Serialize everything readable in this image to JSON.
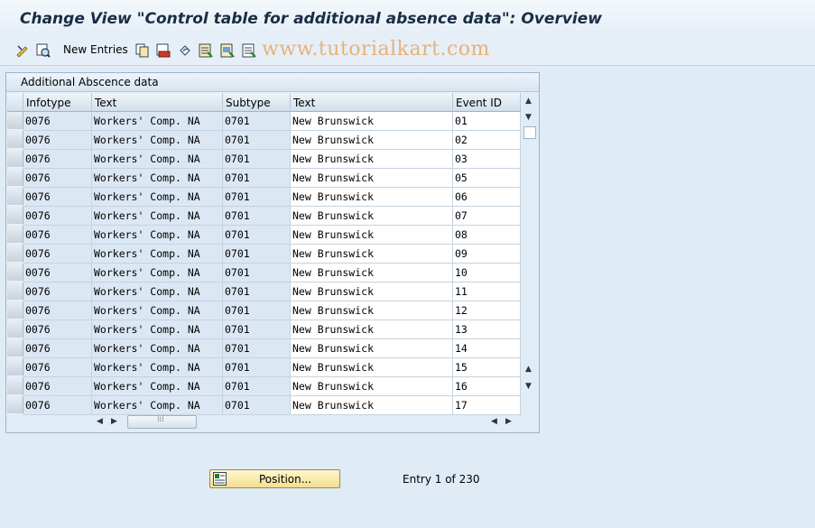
{
  "title": "Change View \"Control table for additional absence data\": Overview",
  "toolbar": {
    "new_entries": "New Entries"
  },
  "watermark": "www.tutorialkart.com",
  "panel": {
    "title": "Additional Abscence data"
  },
  "columns": [
    "Infotype",
    "Text",
    "Subtype",
    "Text",
    "Event ID"
  ],
  "rows": [
    {
      "infotype": "0076",
      "text": "Workers' Comp. NA",
      "subtype": "0701",
      "text2": "New Brunswick",
      "event": "01"
    },
    {
      "infotype": "0076",
      "text": "Workers' Comp. NA",
      "subtype": "0701",
      "text2": "New Brunswick",
      "event": "02"
    },
    {
      "infotype": "0076",
      "text": "Workers' Comp. NA",
      "subtype": "0701",
      "text2": "New Brunswick",
      "event": "03"
    },
    {
      "infotype": "0076",
      "text": "Workers' Comp. NA",
      "subtype": "0701",
      "text2": "New Brunswick",
      "event": "05"
    },
    {
      "infotype": "0076",
      "text": "Workers' Comp. NA",
      "subtype": "0701",
      "text2": "New Brunswick",
      "event": "06"
    },
    {
      "infotype": "0076",
      "text": "Workers' Comp. NA",
      "subtype": "0701",
      "text2": "New Brunswick",
      "event": "07"
    },
    {
      "infotype": "0076",
      "text": "Workers' Comp. NA",
      "subtype": "0701",
      "text2": "New Brunswick",
      "event": "08"
    },
    {
      "infotype": "0076",
      "text": "Workers' Comp. NA",
      "subtype": "0701",
      "text2": "New Brunswick",
      "event": "09"
    },
    {
      "infotype": "0076",
      "text": "Workers' Comp. NA",
      "subtype": "0701",
      "text2": "New Brunswick",
      "event": "10"
    },
    {
      "infotype": "0076",
      "text": "Workers' Comp. NA",
      "subtype": "0701",
      "text2": "New Brunswick",
      "event": "11"
    },
    {
      "infotype": "0076",
      "text": "Workers' Comp. NA",
      "subtype": "0701",
      "text2": "New Brunswick",
      "event": "12"
    },
    {
      "infotype": "0076",
      "text": "Workers' Comp. NA",
      "subtype": "0701",
      "text2": "New Brunswick",
      "event": "13"
    },
    {
      "infotype": "0076",
      "text": "Workers' Comp. NA",
      "subtype": "0701",
      "text2": "New Brunswick",
      "event": "14"
    },
    {
      "infotype": "0076",
      "text": "Workers' Comp. NA",
      "subtype": "0701",
      "text2": "New Brunswick",
      "event": "15"
    },
    {
      "infotype": "0076",
      "text": "Workers' Comp. NA",
      "subtype": "0701",
      "text2": "New Brunswick",
      "event": "16"
    },
    {
      "infotype": "0076",
      "text": "Workers' Comp. NA",
      "subtype": "0701",
      "text2": "New Brunswick",
      "event": "17"
    }
  ],
  "position_button": "Position...",
  "entry_status": "Entry 1 of 230"
}
